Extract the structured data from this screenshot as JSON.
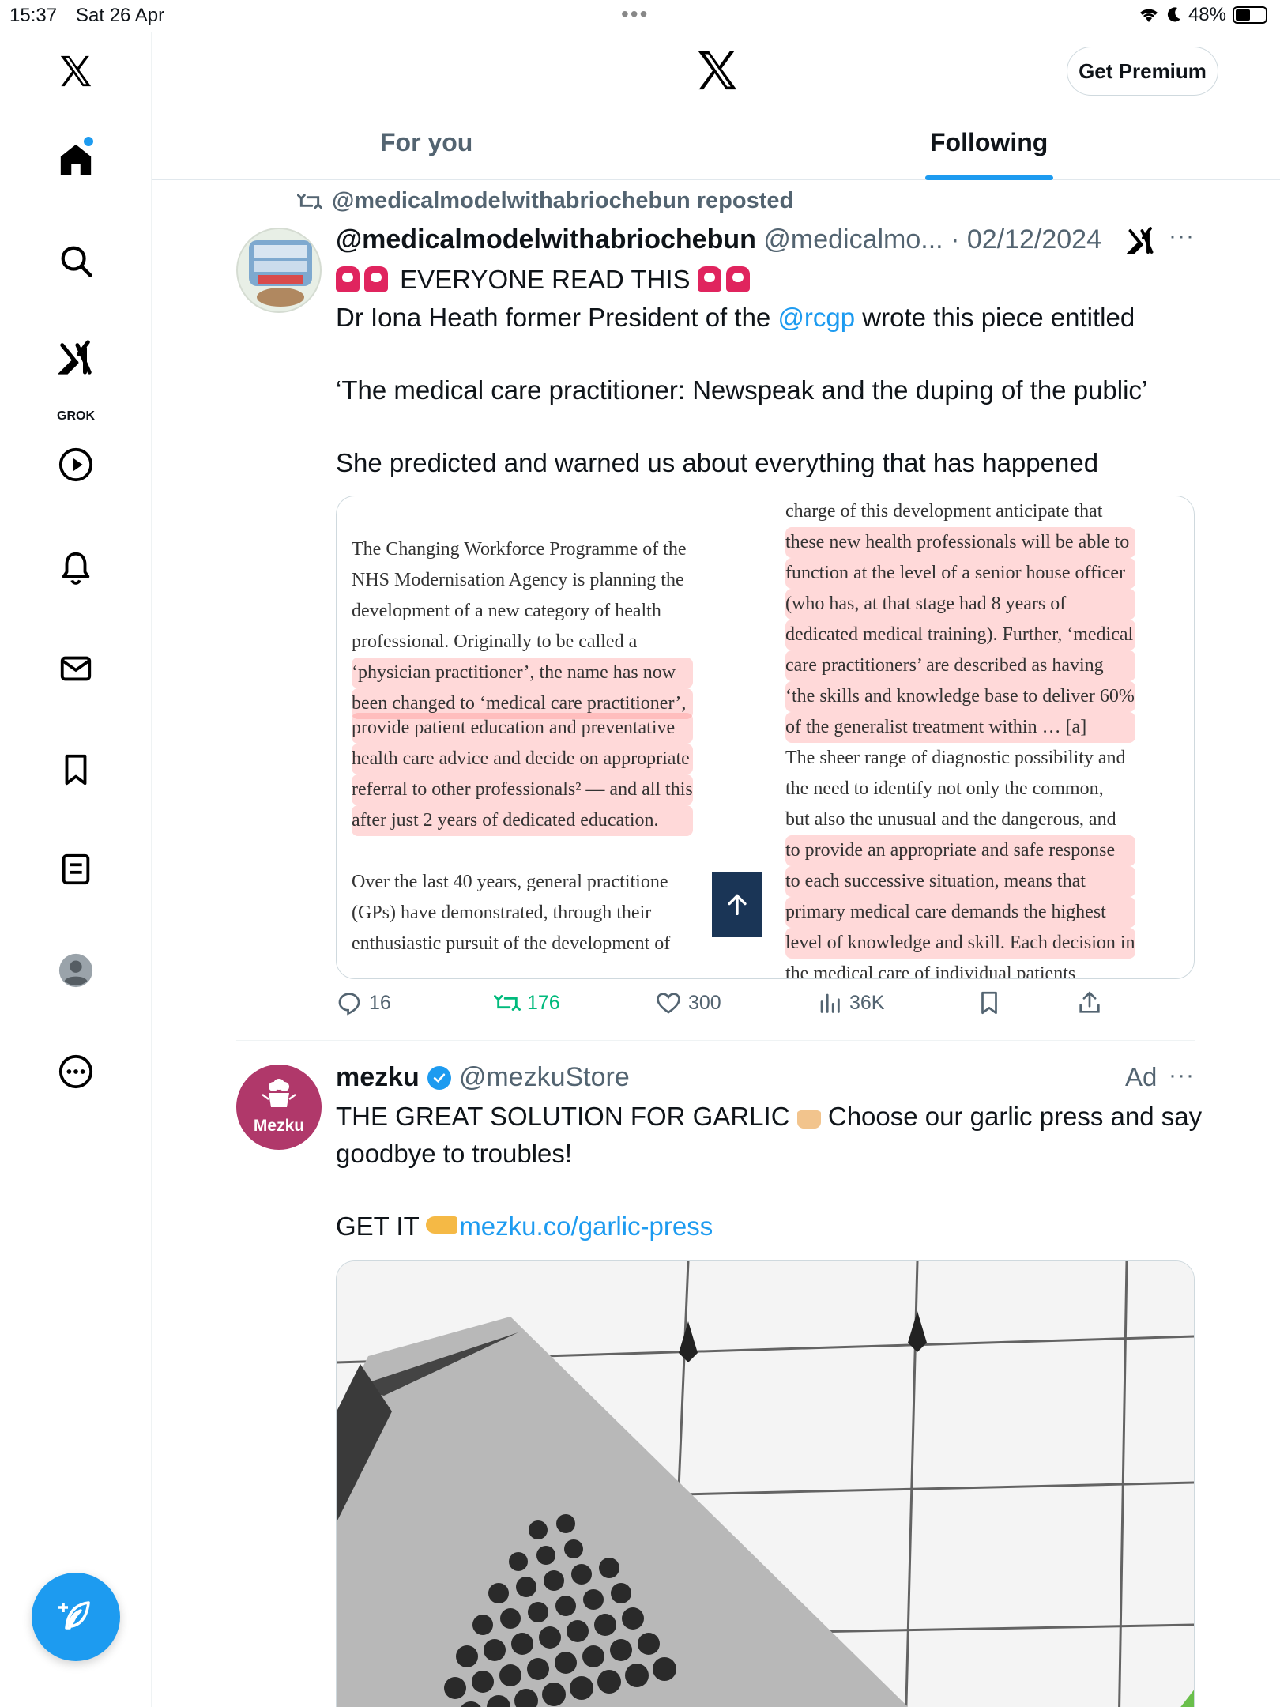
{
  "status_bar": {
    "time": "15:37",
    "date": "Sat 26 Apr",
    "battery": "48%"
  },
  "sidebar": {
    "grok_label": "GROK"
  },
  "header": {
    "premium_button": "Get Premium",
    "tabs": [
      {
        "label": "For you"
      },
      {
        "label": "Following"
      }
    ]
  },
  "post": {
    "repost_label": "@medicalmodelwithabriochebun reposted",
    "author_name": "@medicalmodelwithabriochebun",
    "author_handle": "@medicalmo...",
    "date": "· 02/12/2024",
    "line1": "EVERYONE READ THIS",
    "line2_pre": "Dr Iona Heath former President of the ",
    "line2_mention": "@rcgp",
    "line2_post": " wrote this piece entitled",
    "line3": "‘The medical care practitioner: Newspeak and the duping of the public’",
    "line4": "She predicted and warned us about everything that has happened",
    "media_left": [
      "The Changing Workforce Programme of the",
      "NHS Modernisation Agency is planning the",
      "development of a new category of health",
      "professional. Originally to be called a",
      "‘physician practitioner’, the name has now",
      "been changed to ‘medical care practitioner’,",
      "provide patient education and preventative",
      "health care advice and decide on appropriate",
      "referral to other professionals² — and all this",
      "after just 2 years of dedicated education.",
      "",
      "Over the last 40 years, general practitione",
      "(GPs) have demonstrated, through their",
      "enthusiastic pursuit of the development of"
    ],
    "media_right": [
      "charge of this development anticipate that",
      "these new health professionals will be able to",
      "function at the level of a senior house officer",
      "(who has, at that stage had 8 years of",
      "dedicated medical training). Further, ‘medical",
      "care practitioners’ are described as having",
      "‘the skills and knowledge base to deliver 60%",
      "of the generalist treatment within … [a]",
      "The sheer range of diagnostic possibility and",
      "the need to identify not only the common,",
      "but also the unusual and the dangerous, and",
      "to provide an appropriate and safe response",
      "to each successive situation, means that",
      "primary medical care demands the highest",
      "level of knowledge and skill. Each decision in",
      "the medical care of individual patients"
    ],
    "stats": {
      "replies": "16",
      "reposts": "176",
      "likes": "300",
      "views": "36K"
    }
  },
  "ad": {
    "avatar_text": "Mezku",
    "name": "mezku",
    "handle": "@mezkuStore",
    "label": "Ad",
    "line1": "THE GREAT SOLUTION FOR GARLIC",
    "line1b": "Choose our garlic press and say",
    "line2": "goodbye to troubles!",
    "cta": "GET IT ",
    "link": "mezku.co/garlic-press"
  },
  "colors": {
    "accent": "#1d9bf0",
    "repost_green": "#00ba7c",
    "ad_avatar": "#b0386a",
    "highlight": "#ff7878"
  },
  "icons": [
    "x-logo-icon",
    "home-icon",
    "search-icon",
    "grok-icon",
    "video-icon",
    "bell-icon",
    "mail-icon",
    "bookmark-icon",
    "lists-icon",
    "profile-icon",
    "more-icon",
    "compose-icon",
    "repost-icon",
    "reply-icon",
    "like-icon",
    "views-icon",
    "share-icon",
    "verified-icon"
  ]
}
